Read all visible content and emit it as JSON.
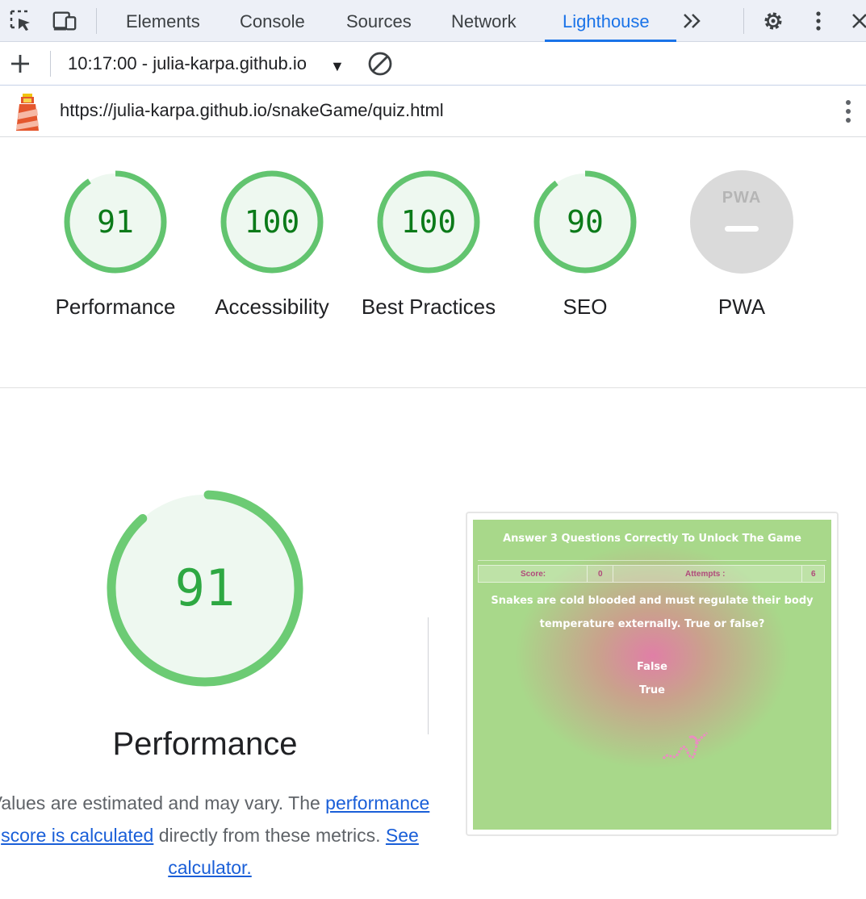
{
  "devtools": {
    "tabs": [
      "Elements",
      "Console",
      "Sources",
      "Network",
      "Lighthouse"
    ],
    "active_tab": "Lighthouse",
    "report_selector": "10:17:00 - julia-karpa.github.io",
    "url": "https://julia-karpa.github.io/snakeGame/quiz.html"
  },
  "gauges": [
    {
      "score": "91",
      "label": "Performance"
    },
    {
      "score": "100",
      "label": "Accessibility"
    },
    {
      "score": "100",
      "label": "Best Practices"
    },
    {
      "score": "90",
      "label": "SEO"
    },
    {
      "badge": "PWA",
      "label": "PWA"
    }
  ],
  "performance": {
    "score": "91",
    "title": "Performance",
    "desc_part1": "Values are estimated and may vary. The ",
    "desc_link1": "performance score is calculated",
    "desc_part2": " directly from these metrics. ",
    "desc_link2": "See calculator."
  },
  "screenshot": {
    "title": "Answer 3 Questions Correctly To Unlock The Game",
    "score_label": "Score:",
    "score_value": "0",
    "attempts_label": "Attempts :",
    "attempts_value": "6",
    "question": "Snakes are cold blooded and must regulate their body temperature externally. True or false?",
    "answer1": "False",
    "answer2": "True"
  },
  "colors": {
    "pass_green": "#0cce6b",
    "gauge_fill": "#eef8f0",
    "accent_blue": "#1a73e8",
    "pwa_gray": "#dadada"
  }
}
